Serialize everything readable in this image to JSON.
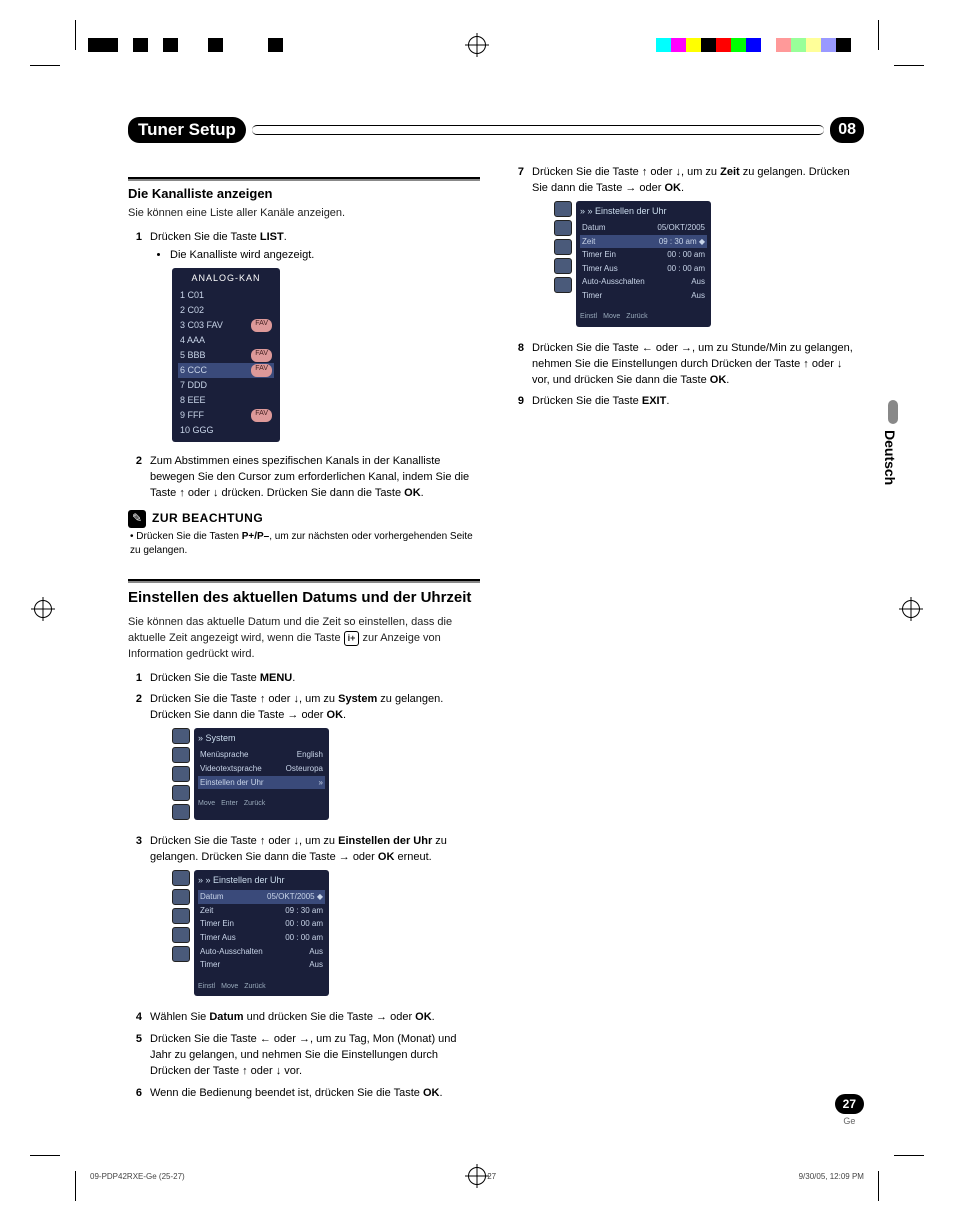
{
  "header": {
    "title": "Tuner Setup",
    "chapter": "08"
  },
  "side": {
    "lang": "Deutsch"
  },
  "pagenum": {
    "num": "27",
    "lang": "Ge"
  },
  "printinfo": {
    "file": "09-PDP42RXE-Ge (25-27)",
    "page": "27",
    "date": "9/30/05, 12:09 PM"
  },
  "colorbar_left": [
    "#000",
    "#000",
    "#fff",
    "#000",
    "#fff",
    "#000",
    "#fff",
    "#fff",
    "#000",
    "#fff",
    "#fff",
    "#fff",
    "#000",
    "#fff"
  ],
  "colorbar_right": [
    "#0ff",
    "#f0f",
    "#ff0",
    "#000",
    "#f00",
    "#0f0",
    "#00f",
    "#fff",
    "#f99",
    "#9f9",
    "#ff9",
    "#99f",
    "#000",
    "#fff"
  ],
  "col1": {
    "sec1": {
      "title": "Die Kanalliste anzeigen",
      "sub": "Sie können eine Liste aller Kanäle anzeigen.",
      "step1_pre": "Drücken Sie die Taste ",
      "step1_b": "LIST",
      "step1_post": ".",
      "step1_bullet": "Die Kanalliste wird angezeigt.",
      "osd_title": "ANALOG-KAN",
      "osd_rows": [
        {
          "l": "1 C01",
          "r": ""
        },
        {
          "l": "2 C02",
          "r": ""
        },
        {
          "l": "3 C03 FAV",
          "r": "FAV"
        },
        {
          "l": "4 AAA",
          "r": ""
        },
        {
          "l": "5 BBB",
          "r": "FAV"
        },
        {
          "l": "6 CCC",
          "r": "FAV"
        },
        {
          "l": "7 DDD",
          "r": ""
        },
        {
          "l": "8 EEE",
          "r": ""
        },
        {
          "l": "9 FFF",
          "r": "FAV"
        },
        {
          "l": "10 GGG",
          "r": ""
        }
      ],
      "step2": "Zum Abstimmen eines spezifischen Kanals in der Kanalliste bewegen Sie den Cursor zum erforderlichen Kanal, indem Sie die Taste ↑ oder ↓ drücken. Drücken Sie dann die Taste ",
      "step2_b": "OK",
      "step2_post": ".",
      "note_title": "ZUR BEACHTUNG",
      "note_text_pre": "Drücken Sie die Tasten ",
      "note_text_b": "P+/P–",
      "note_text_post": ", um zur nächsten oder vorhergehenden Seite zu gelangen."
    },
    "sec2": {
      "title": "Einstellen des aktuellen Datums und der Uhrzeit",
      "sub_pre": "Sie können das aktuelle Datum und die Zeit so einstellen, dass die aktuelle Zeit angezeigt wird, wenn die Taste ",
      "sub_icon": "i+",
      "sub_post": " zur Anzeige von Information gedrückt wird.",
      "step1_pre": "Drücken Sie die Taste ",
      "step1_b": "MENU",
      "step1_post": ".",
      "step2_pre": "Drücken Sie die Taste ↑ oder ↓, um zu ",
      "step2_b": "System",
      "step2_mid": " zu gelangen. Drücken Sie dann die Taste → oder ",
      "step2_b2": "OK",
      "step2_post": ".",
      "osd1_title": "System",
      "osd1_rows": [
        {
          "l": "Menüsprache",
          "r": "English"
        },
        {
          "l": "Videotextsprache",
          "r": "Osteuropa"
        },
        {
          "l": "Einstellen der Uhr",
          "r": "»"
        }
      ],
      "osd1_foot": [
        "Move",
        "Enter",
        "Zurück"
      ],
      "step3_pre": "Drücken Sie die Taste ↑ oder ↓, um zu ",
      "step3_b": "Einstellen der Uhr",
      "step3_mid": " zu gelangen. Drücken Sie dann die Taste → oder ",
      "step3_b2": "OK",
      "step3_post": " erneut.",
      "osd2_title": "Einstellen der Uhr",
      "osd2_rows": [
        {
          "l": "Datum",
          "r": "05/OKT/2005 ◆"
        },
        {
          "l": "Zeit",
          "r": "09 : 30 am"
        },
        {
          "l": "Timer Ein",
          "r": "00 : 00 am"
        },
        {
          "l": "Timer Aus",
          "r": "00 : 00 am"
        },
        {
          "l": "Auto-Ausschalten",
          "r": "Aus"
        },
        {
          "l": "Timer",
          "r": "Aus"
        }
      ],
      "osd2_foot": [
        "Einstl",
        "Move",
        "Zurück"
      ],
      "step4_pre": "Wählen Sie ",
      "step4_b": "Datum",
      "step4_mid": " und drücken Sie die Taste → oder ",
      "step4_b2": "OK",
      "step4_post": ".",
      "step5": "Drücken Sie die Taste ← oder →, um zu Tag, Mon (Monat) und Jahr zu gelangen, und nehmen Sie die Einstellungen durch Drücken der Taste ↑ oder ↓ vor.",
      "step6_pre": "Wenn die Bedienung beendet ist, drücken Sie die Taste ",
      "step6_b": "OK",
      "step6_post": "."
    }
  },
  "col2": {
    "step7_pre": "Drücken Sie die Taste ↑ oder ↓, um zu ",
    "step7_b": "Zeit",
    "step7_mid": " zu gelangen. Drücken Sie dann die Taste → oder ",
    "step7_b2": "OK",
    "step7_post": ".",
    "osd_title": "Einstellen der Uhr",
    "osd_rows": [
      {
        "l": "Datum",
        "r": "05/OKT/2005"
      },
      {
        "l": "Zeit",
        "r": "09 : 30 am ◆"
      },
      {
        "l": "Timer Ein",
        "r": "00 : 00 am"
      },
      {
        "l": "Timer Aus",
        "r": "00 : 00 am"
      },
      {
        "l": "Auto-Ausschalten",
        "r": "Aus"
      },
      {
        "l": "Timer",
        "r": "Aus"
      }
    ],
    "osd_foot": [
      "Einstl",
      "Move",
      "Zurück"
    ],
    "step8_pre": "Drücken Sie die Taste ← oder →, um zu Stunde/Min zu gelangen, nehmen Sie die Einstellungen durch Drücken der Taste ↑ oder ↓ vor, und drücken Sie dann die Taste ",
    "step8_b": "OK",
    "step8_post": ".",
    "step9_pre": "Drücken Sie die Taste ",
    "step9_b": "EXIT",
    "step9_post": "."
  }
}
